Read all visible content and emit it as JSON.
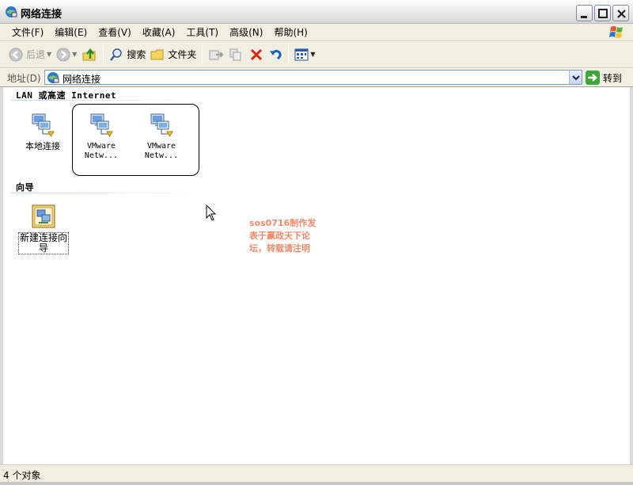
{
  "window": {
    "title": "网络连接",
    "icon": "network-connections-icon"
  },
  "menu": [
    "文件(F)",
    "编辑(E)",
    "查看(V)",
    "收藏(A)",
    "工具(T)",
    "高级(N)",
    "帮助(H)"
  ],
  "toolbar": {
    "back_label": "后退",
    "search_label": "搜索",
    "folders_label": "文件夹"
  },
  "address": {
    "label": "地址(D)",
    "value": "网络连接",
    "go_label": "转到"
  },
  "groups": [
    {
      "header": "LAN 或高速 Internet",
      "items": [
        {
          "label": "本地连接"
        },
        {
          "label_line1": "VMware",
          "label_line2": "Netw..."
        },
        {
          "label_line1": "VMware",
          "label_line2": "Netw..."
        }
      ]
    },
    {
      "header": "向导",
      "items": [
        {
          "label_line1": "新建连接向",
          "label_line2": "导"
        }
      ]
    }
  ],
  "watermark": {
    "line1": "sos0716制作发",
    "line2": "表于赢政天下论",
    "line3": "坛，转载请注明"
  },
  "status": {
    "text": "4 个对象"
  },
  "colors": {
    "chrome": "#f1efe2",
    "watermark": "#f08a6a",
    "address_border": "#7f9db9"
  }
}
